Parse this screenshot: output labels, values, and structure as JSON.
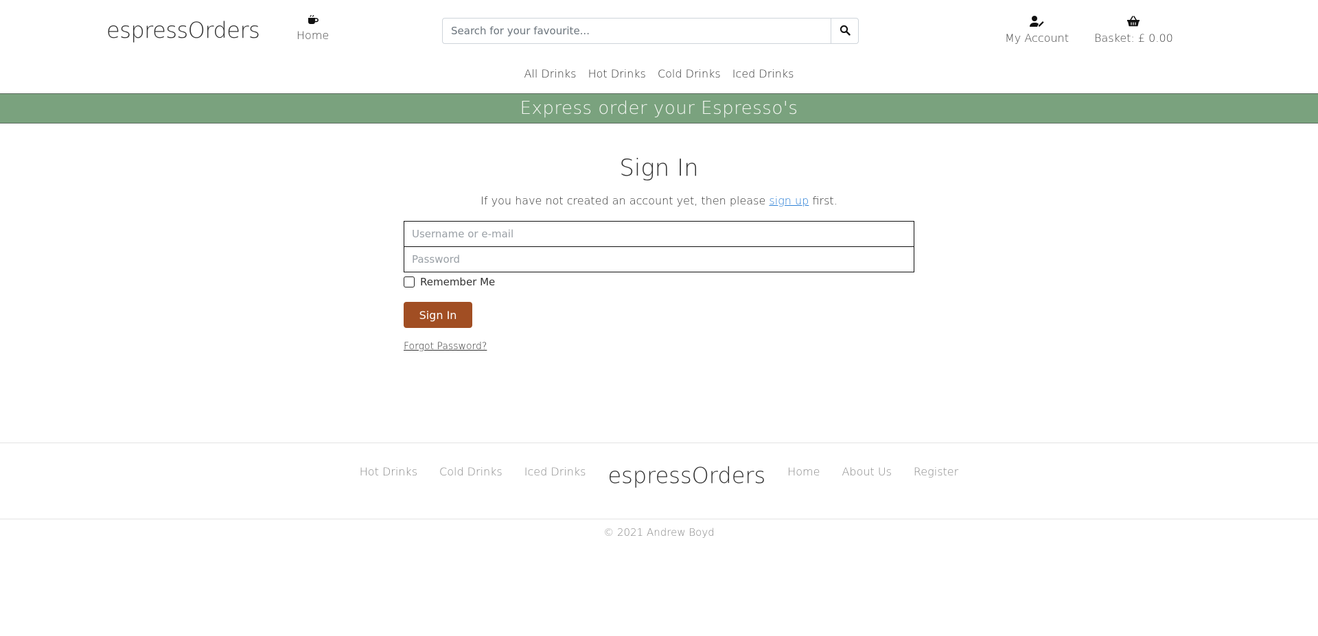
{
  "header": {
    "logo": "espressOrders",
    "home_label": "Home",
    "search": {
      "placeholder": "Search for your favourite...",
      "value": ""
    },
    "account_label": "My Account",
    "basket_label": "Basket: £ 0.00"
  },
  "categories": [
    {
      "label": "All Drinks"
    },
    {
      "label": "Hot Drinks"
    },
    {
      "label": "Cold Drinks"
    },
    {
      "label": "Iced Drinks"
    }
  ],
  "banner": {
    "text": "Express order your Espresso's"
  },
  "signin": {
    "title": "Sign In",
    "note_prefix": "If you have not created an account yet, then please",
    "note_link": "sign up",
    "note_suffix": "first.",
    "username_placeholder": "Username or e-mail",
    "password_placeholder": "Password",
    "remember_label": "Remember Me",
    "button_label": "Sign In",
    "forgot_label": "Forgot Password?"
  },
  "footer": {
    "left_links": [
      {
        "label": "Hot Drinks"
      },
      {
        "label": "Cold Drinks"
      },
      {
        "label": "Iced Drinks"
      }
    ],
    "logo": "espressOrders",
    "right_links": [
      {
        "label": "Home"
      },
      {
        "label": "About Us"
      },
      {
        "label": "Register"
      }
    ],
    "copyright": "© 2021 Andrew Boyd"
  },
  "colors": {
    "banner": "#7aa27e",
    "signin_button": "#a14e23",
    "link": "#2d80d6"
  },
  "icons": {
    "home": "coffee-mug-icon",
    "search": "magnifier-icon",
    "account": "user-edit-icon",
    "basket": "shopping-basket-icon"
  }
}
